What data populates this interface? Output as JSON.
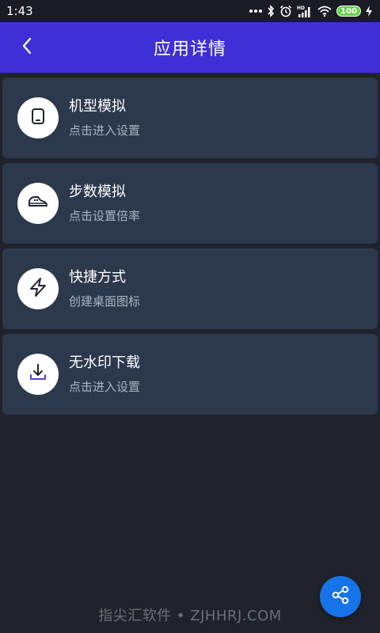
{
  "status_bar": {
    "time": "1:43",
    "battery": "100",
    "icons": [
      "more-dots-icon",
      "bluetooth-icon",
      "alarm-icon",
      "hd-signal-icon",
      "wifi-icon",
      "battery-icon",
      "charging-icon"
    ]
  },
  "header": {
    "title": "应用详情",
    "back_icon": "chevron-left-icon",
    "color": "#3f2fd6"
  },
  "menu": {
    "items": [
      {
        "title": "机型模拟",
        "subtitle": "点击进入设置",
        "icon": "device-icon"
      },
      {
        "title": "步数模拟",
        "subtitle": "点击设置倍率",
        "icon": "shoe-icon"
      },
      {
        "title": "快捷方式",
        "subtitle": "创建桌面图标",
        "icon": "lightning-icon"
      },
      {
        "title": "无水印下载",
        "subtitle": "点击进入设置",
        "icon": "download-icon"
      }
    ]
  },
  "fab": {
    "icon": "share-icon",
    "color": "#1673e8"
  },
  "watermark": "指尖汇软件 • ZJHHRJ.COM"
}
